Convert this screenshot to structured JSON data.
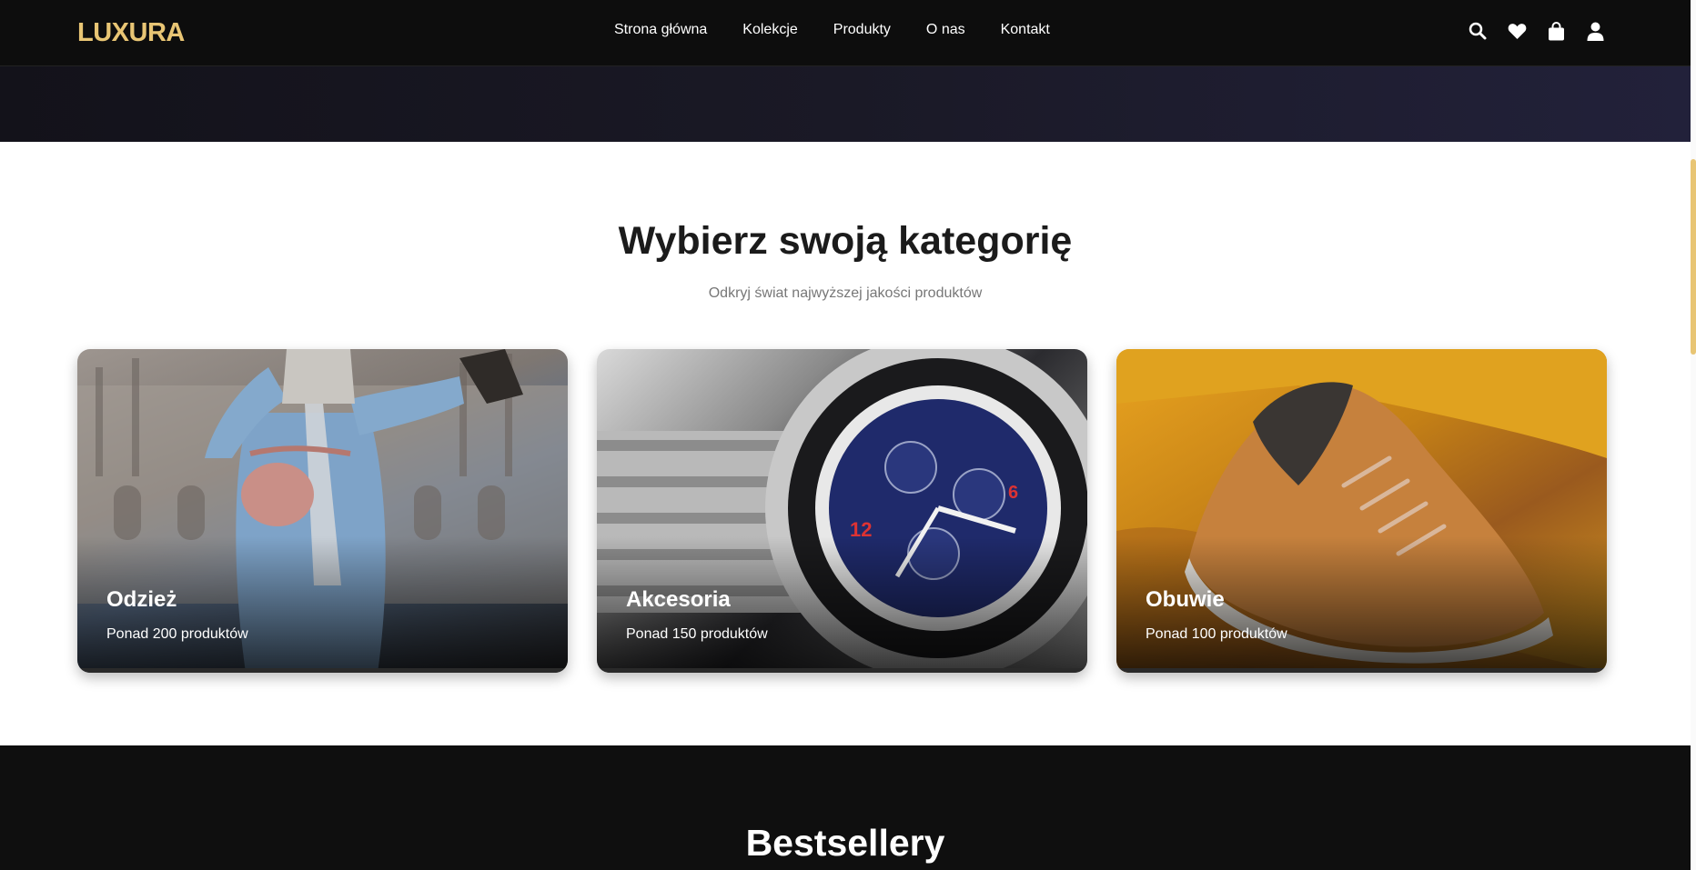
{
  "header": {
    "logo": "LUXURA",
    "nav": [
      "Strona główna",
      "Kolekcje",
      "Produkty",
      "O nas",
      "Kontakt"
    ],
    "icons": [
      "search-icon",
      "heart-icon",
      "shopping-bag-icon",
      "user-icon"
    ]
  },
  "categories": {
    "title": "Wybierz swoją kategorię",
    "subtitle": "Odkryj świat najwyższej jakości produktów",
    "cards": [
      {
        "title": "Odzież",
        "subtitle": "Ponad 200 produktów"
      },
      {
        "title": "Akcesoria",
        "subtitle": "Ponad 150 produktów"
      },
      {
        "title": "Obuwie",
        "subtitle": "Ponad 100 produktów"
      }
    ]
  },
  "bestsellers": {
    "title": "Bestsellery"
  },
  "colors": {
    "accent": "#e8c574",
    "header_bg": "#0d0d0d",
    "dark_section": "#0f0f0f"
  }
}
